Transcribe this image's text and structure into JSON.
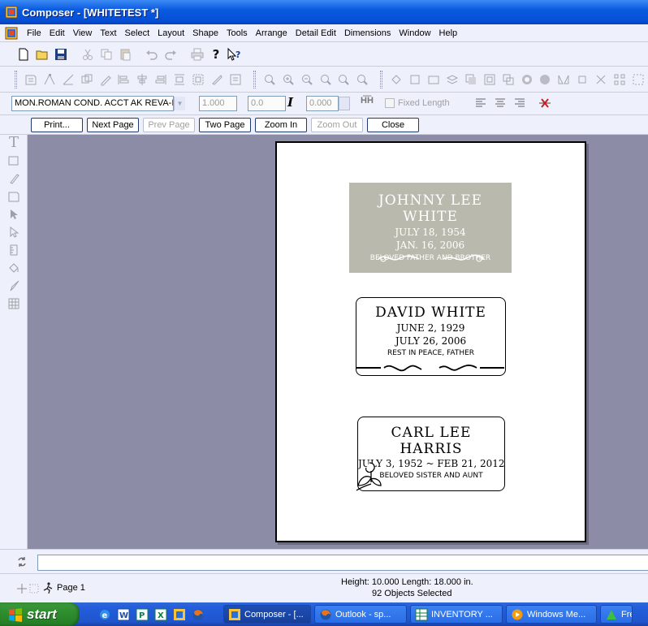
{
  "window": {
    "title": "Composer - [WHITETEST *]"
  },
  "menu": [
    "File",
    "Edit",
    "View",
    "Text",
    "Select",
    "Layout",
    "Shape",
    "Tools",
    "Arrange",
    "Detail Edit",
    "Dimensions",
    "Window",
    "Help"
  ],
  "format_toolbar": {
    "font": "MON.ROMAN COND. ACCT AK REVA-I",
    "size": "1.000",
    "slant": "0.0",
    "spacing": "0.000",
    "fixed_length_label": "Fixed Length"
  },
  "preview_toolbar": {
    "print": "Print...",
    "next_page": "Next Page",
    "prev_page": "Prev Page",
    "two_page": "Two Page",
    "zoom_in": "Zoom In",
    "zoom_out": "Zoom Out",
    "close": "Close"
  },
  "plaques": [
    {
      "name": "JOHNNY LEE WHITE",
      "line1": "JULY 18, 1954",
      "line2": "JAN. 16, 2006",
      "epitaph": "BELOVED FATHER AND BROTHER"
    },
    {
      "name": "DAVID WHITE",
      "line1": "JUNE 2, 1929",
      "line2": "JULY 26, 2006",
      "epitaph": "REST IN PEACE, FATHER"
    },
    {
      "name": "CARL LEE HARRIS",
      "line1": "JULY 3, 1952 ~ FEB 21, 2012",
      "epitaph": "BELOVED SISTER AND AUNT"
    }
  ],
  "status": {
    "page": "Page 1",
    "dimensions": "Height: 10.000  Length: 18.000  in.",
    "selection": "92 Objects Selected"
  },
  "taskbar": {
    "start": "start",
    "tasks": [
      "Composer - [...",
      "Outlook - sp...",
      "INVENTORY ...",
      "Windows Me...",
      "Fre"
    ]
  },
  "colors": {
    "plaque1_fill": "#B9B9AD",
    "canvas": "#8C8CA6",
    "toolbar": "#EEF0FB"
  }
}
